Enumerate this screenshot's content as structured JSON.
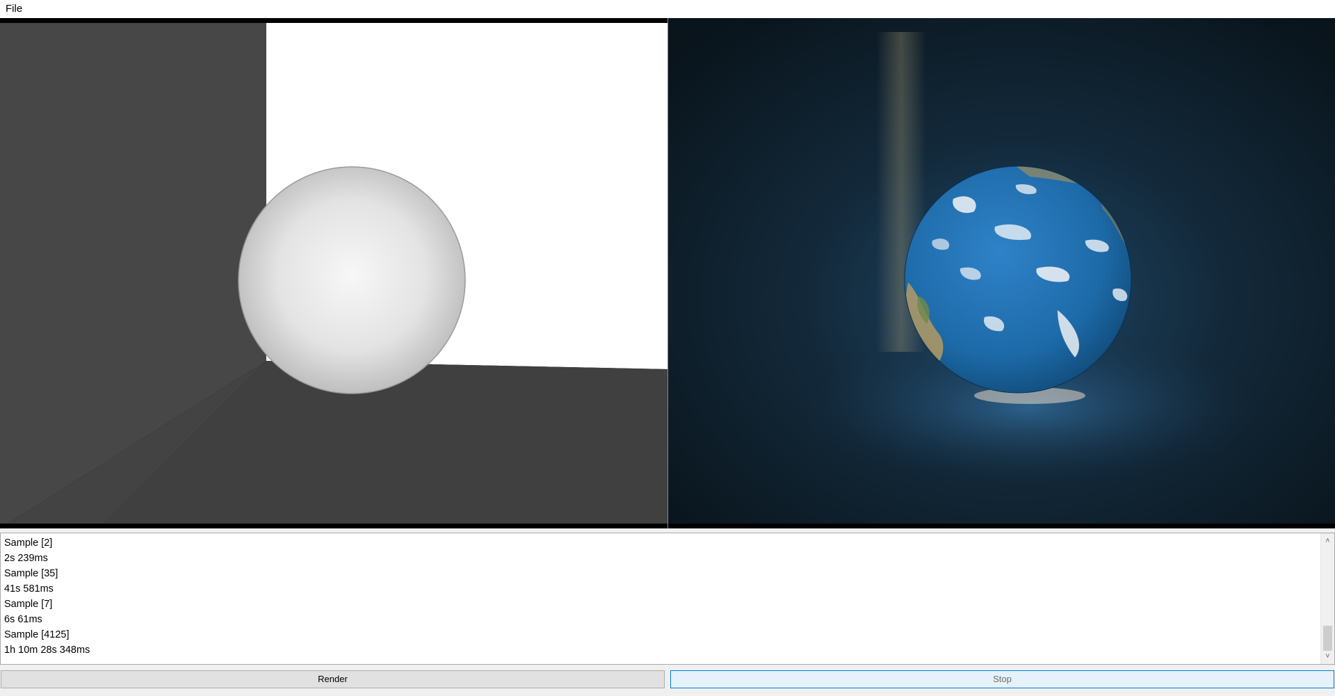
{
  "menu": {
    "file_label": "File"
  },
  "log": {
    "lines": [
      "Sample [2]",
      "2s 239ms",
      "Sample [35]",
      "41s 581ms",
      "Sample [7]",
      "6s 61ms",
      "Sample [4125]",
      "1h 10m 28s 348ms"
    ]
  },
  "buttons": {
    "render_label": "Render",
    "stop_label": "Stop"
  },
  "scroll_position": 0.85,
  "colors": {
    "preview_wall_dark": "#474747",
    "preview_wall_light": "#ffffff",
    "preview_floor": "#404040",
    "render_background": "#0d1b24",
    "earth_ocean": "#1d6aa8",
    "stop_button_border": "#0078d7"
  },
  "icons": {
    "scroll_up": "chevron-up-icon",
    "scroll_down": "chevron-down-icon"
  }
}
